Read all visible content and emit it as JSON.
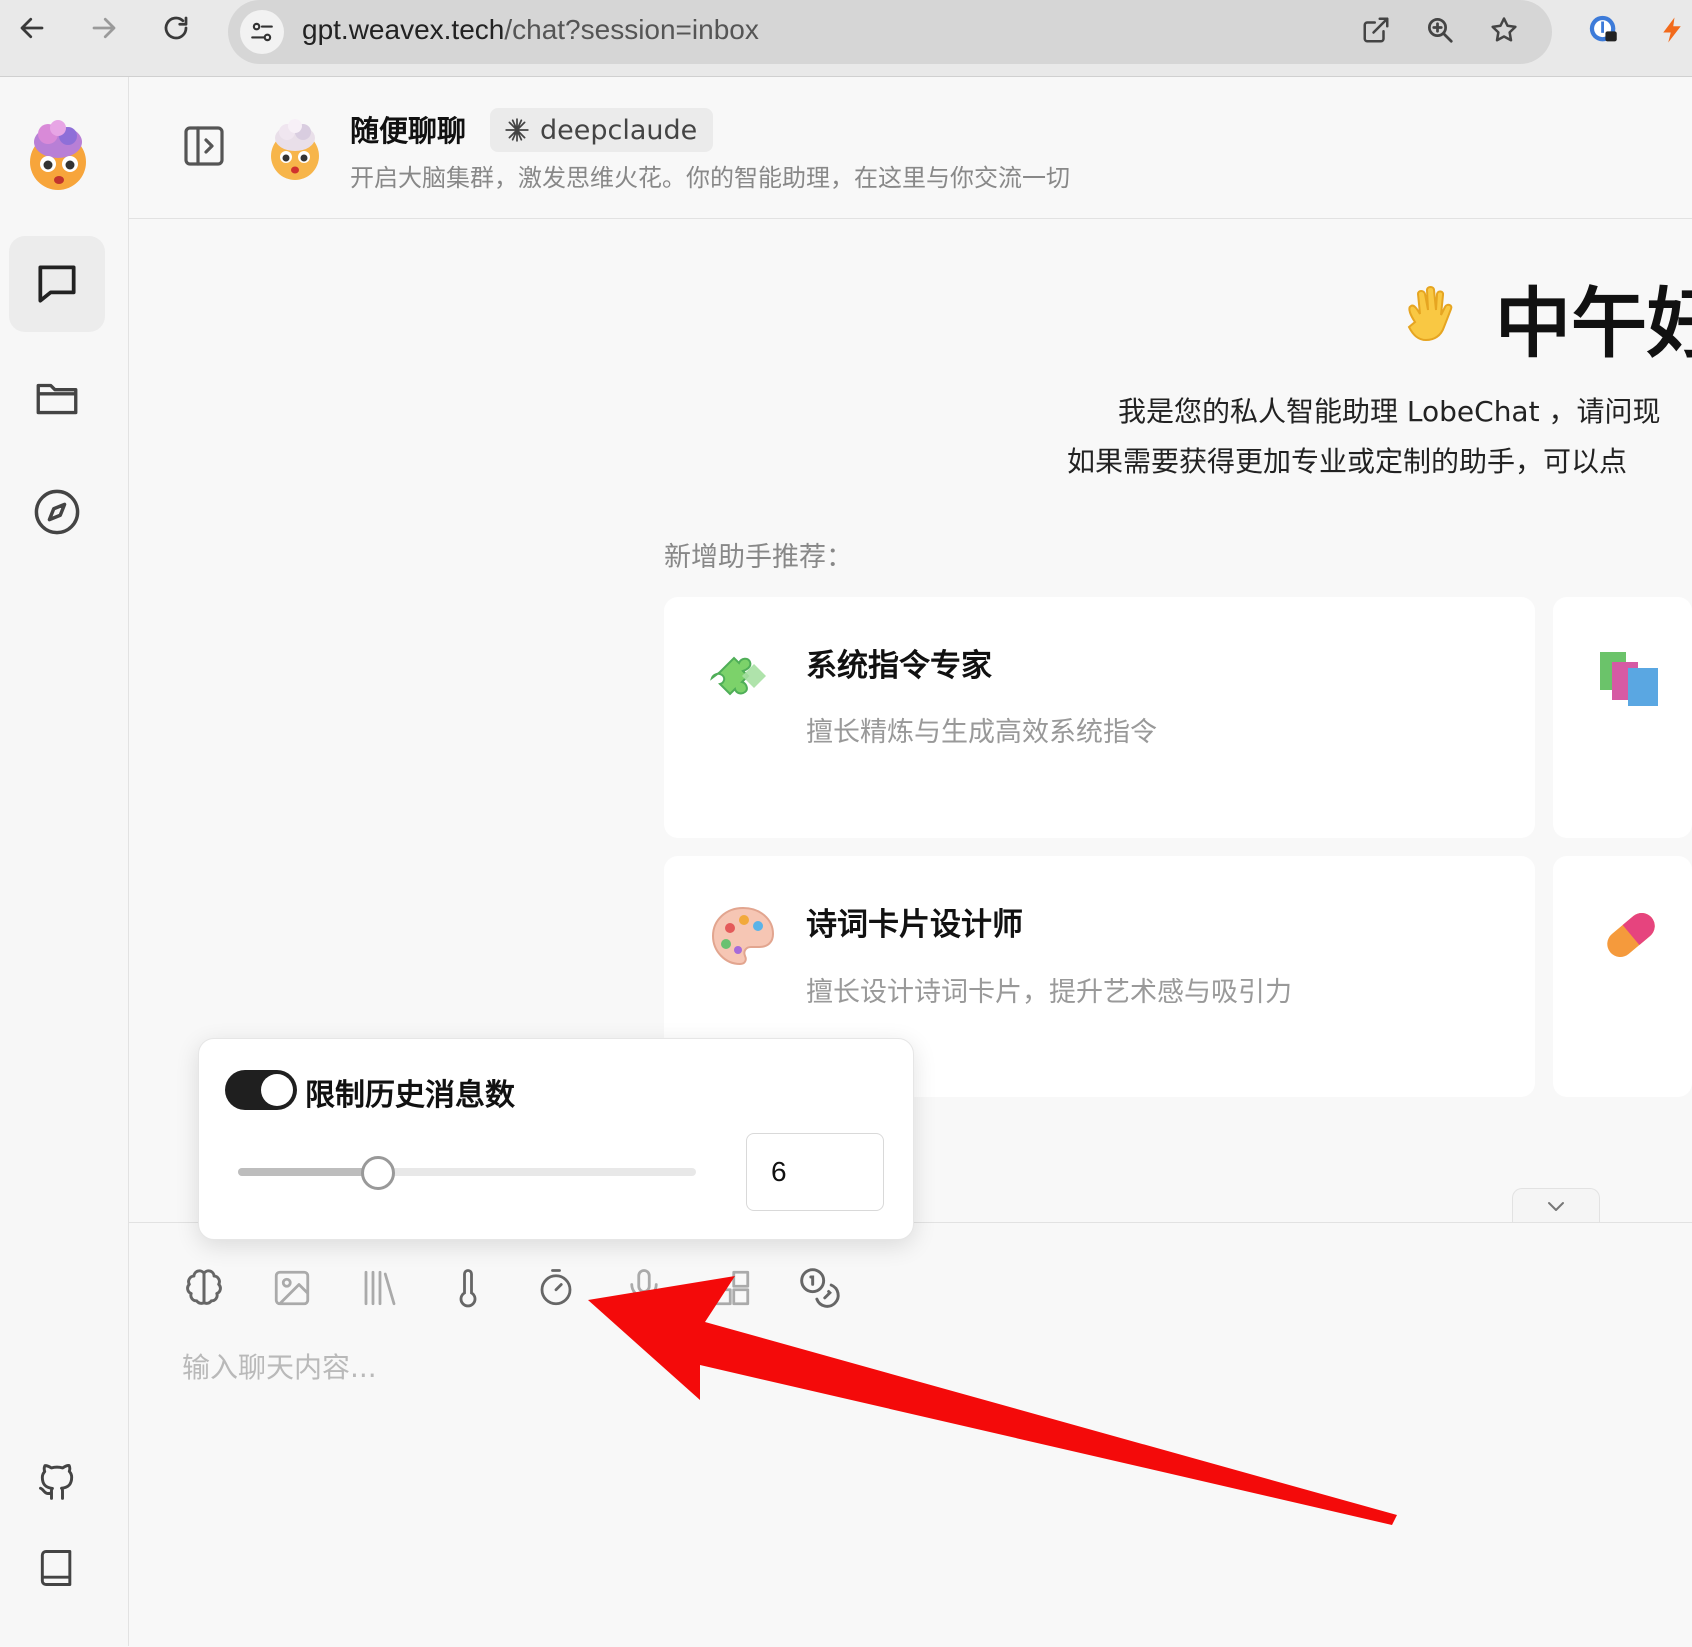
{
  "browser": {
    "url_host": "gpt.weavex.tech",
    "url_path": "/chat?session=inbox"
  },
  "header": {
    "agent_name": "随便聊聊",
    "model_tag": "deepclaude",
    "description": "开启大脑集群，激发思维火花。你的智能助理，在这里与你交流一切"
  },
  "welcome": {
    "greeting": "中午好",
    "intro_line1": "我是您的私人智能助理 LobeChat ，请问现",
    "intro_line2": "如果需要获得更加专业或定制的助手，可以点"
  },
  "recommend": {
    "title": "新增助手推荐：",
    "cards": [
      {
        "title": "系统指令专家",
        "desc": "擅长精炼与生成高效系统指令"
      },
      {
        "title": "诗词卡片设计师",
        "desc": "擅长设计诗词卡片，提升艺术感与吸引力"
      }
    ]
  },
  "history_limit": {
    "label": "限制历史消息数",
    "enabled": true,
    "value": "6",
    "slider_fraction": 0.3
  },
  "chat_input": {
    "placeholder": "输入聊天内容..."
  },
  "annotation": {
    "arrow_color": "#f40a0a"
  }
}
